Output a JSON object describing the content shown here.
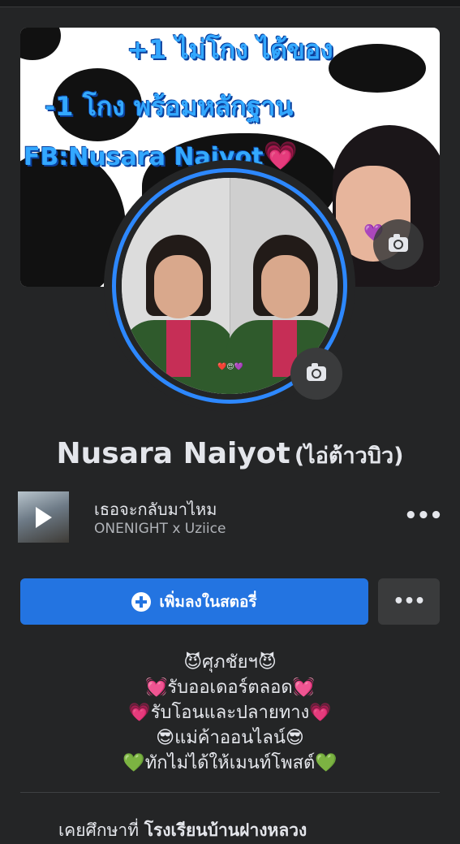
{
  "cover": {
    "line1": "+1 ไม่โกง ได้ของ",
    "line2": "-1 โกง พร้อมหลักฐาน",
    "line3": "FB:Nusara Naiyot",
    "line3_emoji": "💗",
    "purple_heart": "💜"
  },
  "profile": {
    "name": "Nusara Naiyot",
    "alternate_name": "(ไอ่ต้าวบิว)",
    "avatar_emoji": "❤️😍💜"
  },
  "music": {
    "title": "เธอจะกลับมาไหม",
    "artist": "ONENIGHT x Uziice",
    "more_label": "•••"
  },
  "actions": {
    "add_story_label": "เพิ่มลงในสตอรี่",
    "more_label": "•••"
  },
  "bio": {
    "lines": [
      {
        "emoji_left": "😈",
        "text": "ศุภชัยฯ",
        "emoji_right": "😈"
      },
      {
        "emoji_left": "💓",
        "text": "รับออเดอร์ตลอด",
        "emoji_right": "💓"
      },
      {
        "emoji_left": "💗",
        "text": "รับโอนและปลายทาง",
        "emoji_right": "💗"
      },
      {
        "emoji_left": "😎",
        "text": "แม่ค้าออนไลน์",
        "emoji_right": "😎"
      },
      {
        "emoji_left": "💚",
        "text": "ทักไม่ได้ให้เมนท์โพสต์",
        "emoji_right": "💚"
      }
    ]
  },
  "education": {
    "prefix": "เคยศึกษาที่ ",
    "school": "โรงเรียนบ้านฝางหลวง"
  },
  "colors": {
    "background": "#242526",
    "primary_button": "#2374e1",
    "avatar_ring": "#2d88ff",
    "secondary_button": "#3a3b3c"
  },
  "icons": [
    "camera-icon",
    "play-icon",
    "plus-circle-icon",
    "more-icon"
  ]
}
